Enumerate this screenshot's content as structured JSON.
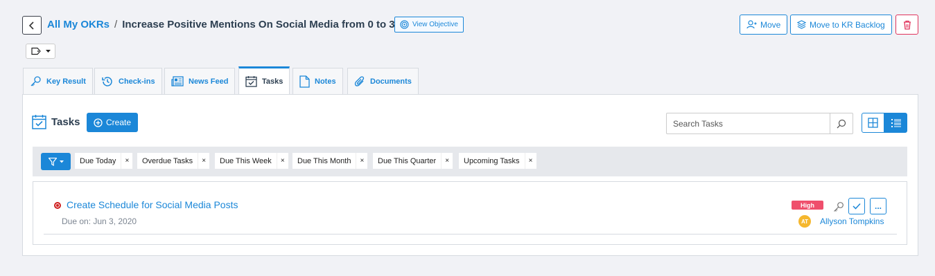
{
  "breadcrumb": {
    "root": "All My OKRs",
    "separator": "/",
    "title": "Increase Positive Mentions On Social Media from 0 to 35"
  },
  "header": {
    "view_objective": "View Objective",
    "move": "Move",
    "move_backlog": "Move to KR Backlog"
  },
  "tabs": [
    {
      "label": "Key Result",
      "icon": "key-icon"
    },
    {
      "label": "Check-ins",
      "icon": "history-icon"
    },
    {
      "label": "News Feed",
      "icon": "newspaper-icon"
    },
    {
      "label": "Tasks",
      "icon": "calendar-check-icon",
      "active": true
    },
    {
      "label": "Notes",
      "icon": "document-icon"
    },
    {
      "label": "Documents",
      "icon": "paperclip-icon"
    }
  ],
  "tasks_section": {
    "title": "Tasks",
    "create_label": "Create",
    "search_placeholder": "Search Tasks"
  },
  "filters": [
    {
      "label": "Due Today",
      "remove": "×"
    },
    {
      "label": "Overdue Tasks",
      "remove": "×"
    },
    {
      "label": "Due This Week",
      "remove": "×"
    },
    {
      "label": "Due This Month",
      "remove": "×"
    },
    {
      "label": "Due This Quarter",
      "remove": "×"
    },
    {
      "label": "Upcoming Tasks",
      "remove": "×"
    }
  ],
  "task": {
    "title": "Create Schedule for Social Media Posts",
    "due": "Due on: Jun 3, 2020",
    "priority": "High",
    "assignee_initials": "AT",
    "assignee": "Allyson Tompkins",
    "more": "..."
  },
  "colors": {
    "accent": "#1b87d8",
    "danger": "#e0325b",
    "priority_high": "#ef4f6c",
    "avatar": "#f5b72e"
  }
}
